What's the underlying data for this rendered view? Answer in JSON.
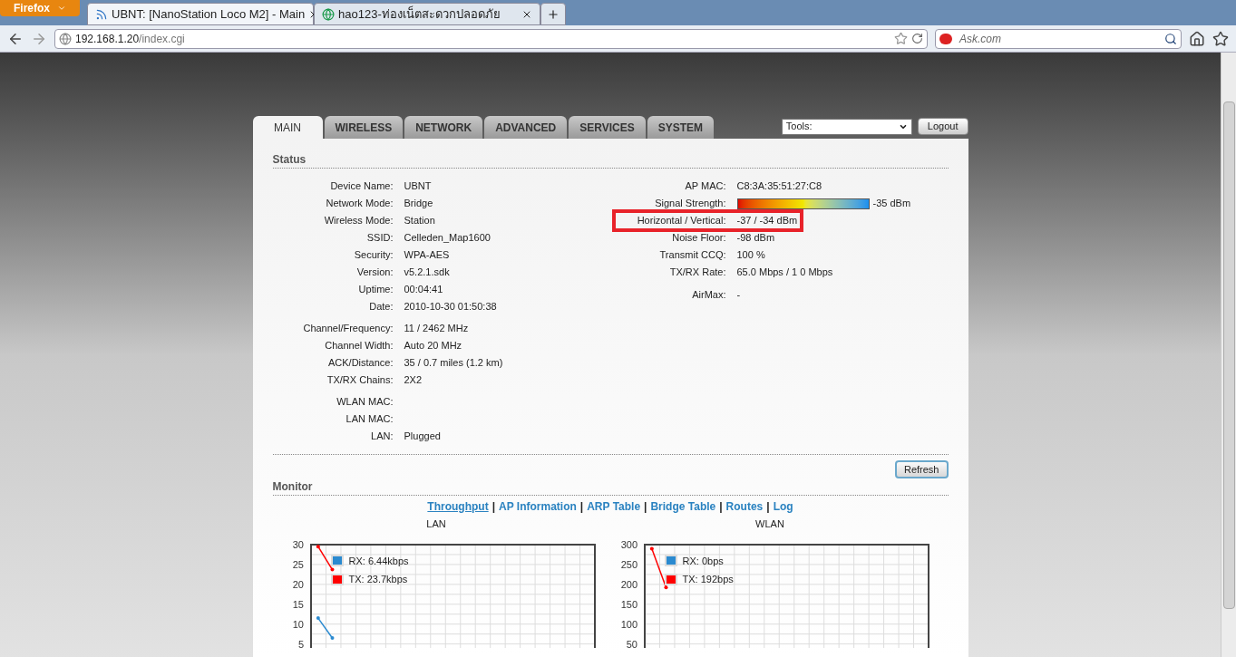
{
  "browser": {
    "menu_button": "Firefox",
    "tabs": [
      {
        "title": "UBNT: [NanoStation Loco M2] - Main",
        "selected": true,
        "kind": "feed"
      },
      {
        "title": "hao123-ท่องเน็ตสะดวกปลอดภัย",
        "selected": false,
        "kind": "site"
      }
    ],
    "address": {
      "host": "192.168.1.20",
      "path": "/index.cgi"
    },
    "search": {
      "placeholder": "Ask.com"
    }
  },
  "nav_tabs": [
    {
      "label": "MAIN",
      "selected": true
    },
    {
      "label": "WIRELESS",
      "selected": false
    },
    {
      "label": "NETWORK",
      "selected": false
    },
    {
      "label": "ADVANCED",
      "selected": false
    },
    {
      "label": "SERVICES",
      "selected": false
    },
    {
      "label": "SYSTEM",
      "selected": false
    }
  ],
  "tools": {
    "value": "Tools:"
  },
  "logout": "Logout",
  "status": {
    "title": "Status",
    "left_groups": [
      [
        {
          "label": "Device Name:",
          "value": "UBNT"
        },
        {
          "label": "Network Mode:",
          "value": "Bridge"
        },
        {
          "label": "Wireless Mode:",
          "value": "Station"
        },
        {
          "label": "SSID:",
          "value": "Celleden_Map1600"
        },
        {
          "label": "Security:",
          "value": "WPA-AES"
        },
        {
          "label": "Version:",
          "value": "v5.2.1.sdk"
        },
        {
          "label": "Uptime:",
          "value": "00:04:41"
        },
        {
          "label": "Date:",
          "value": "2010-10-30 01:50:38"
        }
      ],
      [
        {
          "label": "Channel/Frequency:",
          "value": "11 / 2462 MHz"
        },
        {
          "label": "Channel Width:",
          "value": "Auto 20 MHz"
        },
        {
          "label": "ACK/Distance:",
          "value": "35 / 0.7 miles (1.2 km)"
        },
        {
          "label": "TX/RX Chains:",
          "value": "2X2"
        }
      ],
      [
        {
          "label": "WLAN MAC:"
        },
        {
          "label": "LAN MAC:"
        },
        {
          "label": "LAN:",
          "value": "Plugged"
        }
      ]
    ],
    "right_groups": [
      [
        {
          "kind": "text",
          "label": "AP MAC:",
          "value": "C8:3A:35:51:27:C8",
          "highlighted": false
        },
        {
          "kind": "signal",
          "label": "Signal Strength:",
          "level": 1,
          "value": "-35 dBm",
          "highlighted": false
        },
        {
          "kind": "text",
          "label": "Horizontal / Vertical:",
          "value": "-37 / -34 dBm",
          "highlighted": true
        },
        {
          "kind": "text",
          "label": "Noise Floor:",
          "value": "-98 dBm",
          "highlighted": false
        },
        {
          "kind": "text",
          "label": "Transmit CCQ:",
          "value": "100 %",
          "highlighted": false
        },
        {
          "kind": "text",
          "label": "TX/RX Rate:",
          "value": "65.0 Mbps / 1 0 Mbps",
          "highlighted": false
        }
      ],
      [
        {
          "kind": "text",
          "label": "AirMax:",
          "value": "-",
          "highlighted": false
        }
      ]
    ]
  },
  "refresh": "Refresh",
  "monitor": {
    "title": "Monitor",
    "link_separator": "|",
    "links": [
      {
        "label": "Throughput",
        "selected": true
      },
      {
        "label": "AP Information",
        "selected": false
      },
      {
        "label": "ARP Table",
        "selected": false
      },
      {
        "label": "Bridge Table",
        "selected": false
      },
      {
        "label": "Routes",
        "selected": false
      },
      {
        "label": "Log",
        "selected": false
      }
    ],
    "charts": [
      {
        "chart_data": {
          "type": "line",
          "title": "LAN",
          "grid": true,
          "legend": true,
          "categories": [
            null,
            null,
            null,
            null,
            null,
            null,
            null,
            null,
            null,
            null,
            null,
            null,
            null,
            null,
            null,
            null,
            null,
            null,
            null,
            null
          ],
          "ylim": [
            4,
            30
          ],
          "yticks": [
            5,
            10,
            15,
            20,
            25,
            30
          ],
          "series": [
            {
              "name": "RX: 6.44kbps",
              "color": "#2a8ad0",
              "values": [
                11.5,
                6.5,
                null,
                null,
                null,
                null,
                null,
                null,
                null,
                null,
                null,
                null,
                null,
                null,
                null,
                null,
                null,
                null,
                null,
                null
              ]
            },
            {
              "name": "TX: 23.7kbps",
              "color": "#ff0000",
              "values": [
                29.5,
                23.7,
                null,
                null,
                null,
                null,
                null,
                null,
                null,
                null,
                null,
                null,
                null,
                null,
                null,
                null,
                null,
                null,
                null,
                null
              ]
            }
          ]
        }
      },
      {
        "chart_data": {
          "type": "line",
          "title": "WLAN",
          "grid": true,
          "legend": true,
          "categories": [
            null,
            null,
            null,
            null,
            null,
            null,
            null,
            null,
            null,
            null,
            null,
            null,
            null,
            null,
            null,
            null,
            null,
            null,
            null,
            null
          ],
          "ylim": [
            40,
            300
          ],
          "yticks": [
            50,
            100,
            150,
            200,
            250,
            300
          ],
          "series": [
            {
              "name": "RX: 0bps",
              "color": "#2a8ad0",
              "values": [
                null,
                null,
                null,
                null,
                null,
                null,
                null,
                null,
                null,
                null,
                null,
                null,
                null,
                null,
                null,
                null,
                null,
                null,
                null,
                null
              ]
            },
            {
              "name": "TX: 192bps",
              "color": "#ff0000",
              "values": [
                290,
                192,
                null,
                null,
                null,
                null,
                null,
                null,
                null,
                null,
                null,
                null,
                null,
                null,
                null,
                null,
                null,
                null,
                null,
                null
              ]
            }
          ]
        }
      }
    ]
  }
}
